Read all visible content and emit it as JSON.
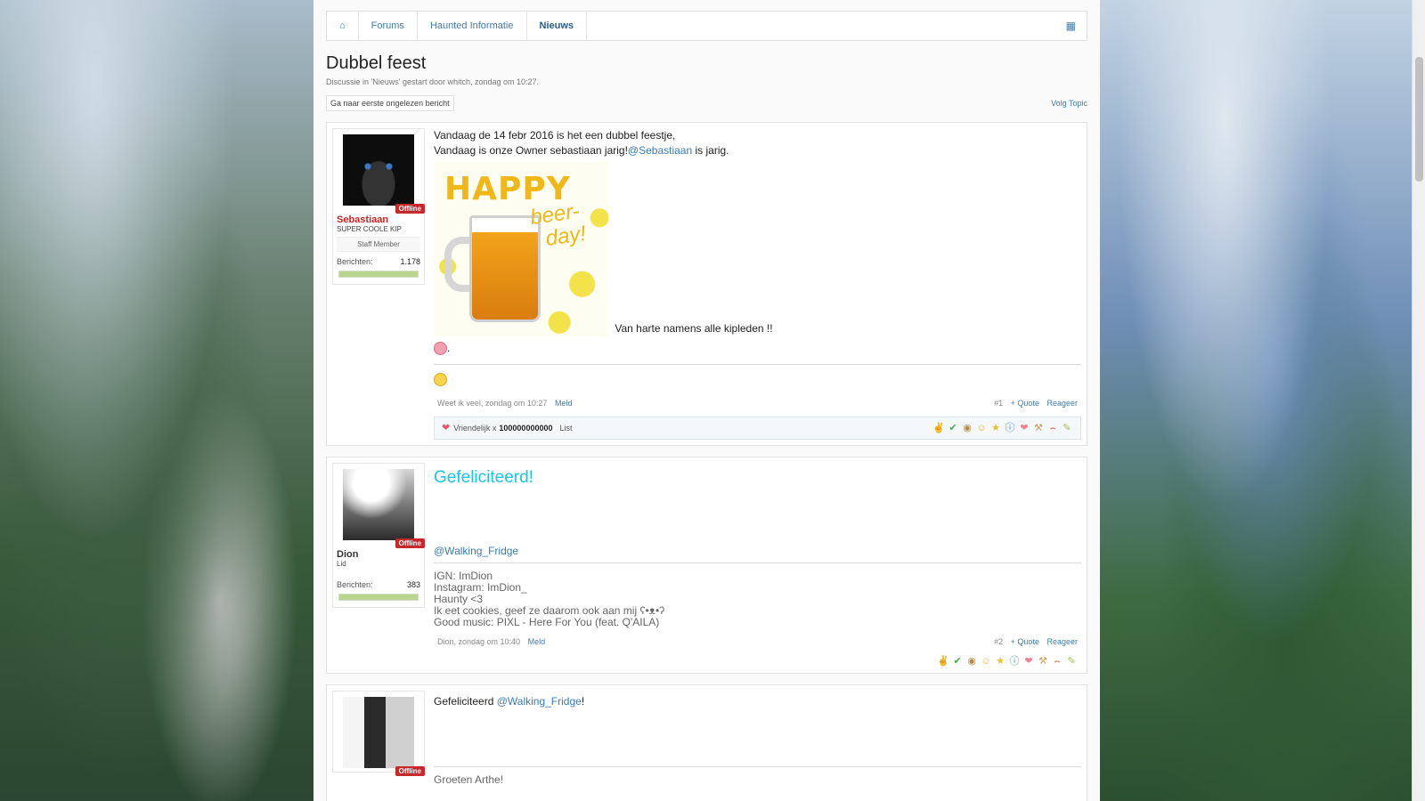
{
  "breadcrumb": {
    "items": [
      "Forums",
      "Haunted Informatie",
      "Nieuws"
    ]
  },
  "thread": {
    "title": "Dubbel feest",
    "meta": "Discussie in 'Nieuws' gestart door whitch, zondag om 10:27.",
    "unread_button": "Ga naar eerste ongelezen bericht",
    "follow": "Volg Topic"
  },
  "posts": [
    {
      "user": {
        "name": "Sebastiaan",
        "title": "SUPER COOLE KIP",
        "role": "Staff Member",
        "status": "Offline",
        "stats_label": "Berichten:",
        "stats_value": "1.178",
        "name_color": "#cc2222"
      },
      "line1": "Vandaag de 14 febr 2016 is het een dubbel feestje,",
      "line2_pre": "Vandaag is onze Owner sebastiaan jarig!",
      "line2_mention": "@Sebastiaan",
      "line2_post": " is jarig.",
      "image_text_1": "HAPPY",
      "image_text_2": "beer-",
      "image_text_3": "day!",
      "caption": "Van harte namens alle kipleden !!",
      "dot": ".",
      "footer_left": "Weet ik veel, zondag om 10:27",
      "report": "Meld",
      "number": "#1",
      "quote": "+ Quote",
      "reply": "Reageer",
      "likes_label": "Vriendelijk x",
      "likes_count": "100000000000",
      "likes_list": "List"
    },
    {
      "user": {
        "name": "Dion",
        "title": "Lid",
        "status": "Offline",
        "stats_label": "Berichten:",
        "stats_value": "383",
        "name_color": "#333333"
      },
      "headline": "Gefeliciteerd!",
      "mention": "@Walking_Fridge",
      "signature": [
        "IGN: ImDion",
        "Instagram: ImDion_",
        "Haunty <3",
        "Ik eet cookies, geef ze daarom ook aan mij ʕ•ᴥ•ʔ",
        "Good music: PIXL - Here For You (feat. Q'AILA)"
      ],
      "footer_left": "Dion, zondag om 10:40",
      "report": "Meld",
      "number": "#2",
      "quote": "+ Quote",
      "reply": "Reageer"
    },
    {
      "user": {
        "status": "Offline"
      },
      "text_pre": "Gefeliciteerd ",
      "mention": "@Walking_Fridge",
      "text_post": "!",
      "signature_start": "Groeten Arthe!"
    }
  ],
  "icons": {
    "home": "home-icon",
    "sitemap": "sitemap-icon",
    "ratings": [
      "thumbs-up-icon",
      "check-icon",
      "cookie-icon",
      "smile-icon",
      "star-icon",
      "info-icon",
      "heart-icon",
      "wrench-icon",
      "rainbow-icon",
      "brush-icon"
    ]
  }
}
